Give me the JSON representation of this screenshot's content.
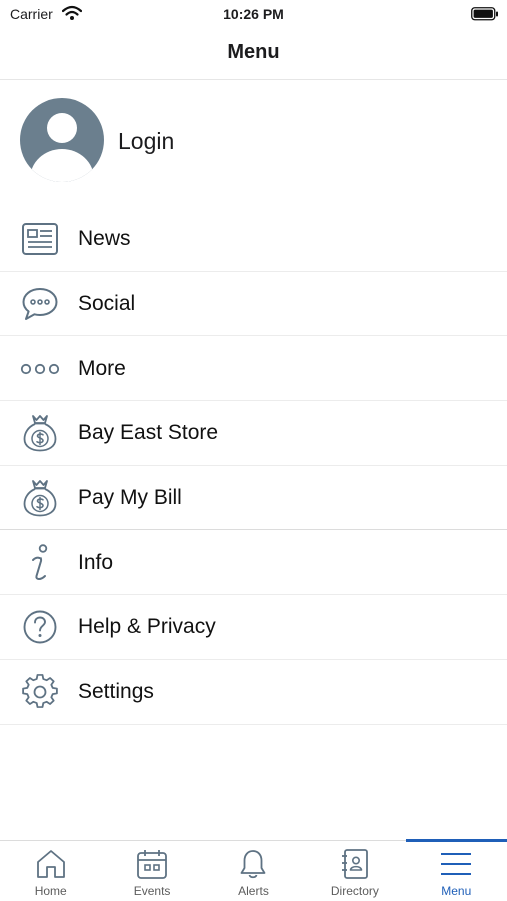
{
  "status_bar": {
    "carrier": "Carrier",
    "time": "10:26 PM"
  },
  "nav": {
    "title": "Menu"
  },
  "profile": {
    "label": "Login",
    "icon": "avatar-icon"
  },
  "menu_items": [
    {
      "label": "News",
      "icon": "newspaper-icon"
    },
    {
      "label": "Social",
      "icon": "chat-bubble-icon"
    },
    {
      "label": "More",
      "icon": "more-dots-icon"
    },
    {
      "label": "Bay East Store",
      "icon": "money-bag-icon"
    },
    {
      "label": "Pay My Bill",
      "icon": "money-bag-icon"
    },
    {
      "label": "Info",
      "icon": "info-icon"
    },
    {
      "label": "Help & Privacy",
      "icon": "help-icon"
    },
    {
      "label": "Settings",
      "icon": "gear-icon"
    }
  ],
  "tabs": [
    {
      "label": "Home",
      "icon": "home-icon"
    },
    {
      "label": "Events",
      "icon": "calendar-icon"
    },
    {
      "label": "Alerts",
      "icon": "bell-icon"
    },
    {
      "label": "Directory",
      "icon": "contacts-book-icon"
    },
    {
      "label": "Menu",
      "icon": "hamburger-icon"
    }
  ],
  "active_tab": "Menu",
  "colors": {
    "accent": "#1f5fb8",
    "icon": "#5e7283",
    "avatar": "#6b7f8e"
  }
}
